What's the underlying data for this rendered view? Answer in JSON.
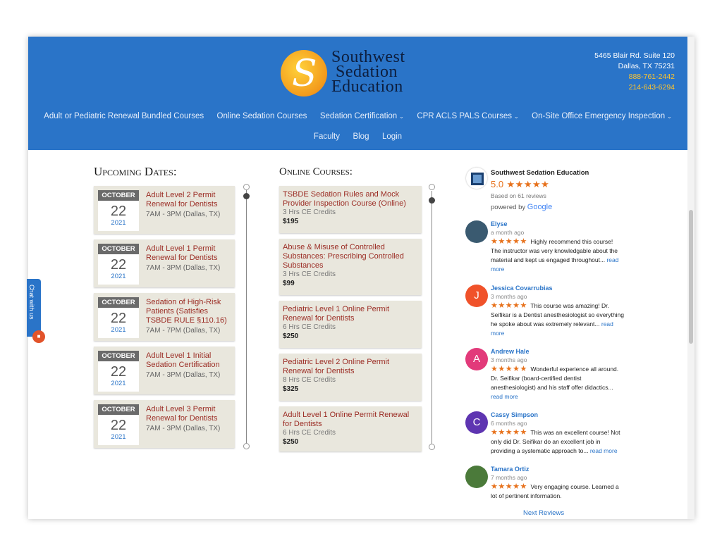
{
  "brand": {
    "logo_letter": "S",
    "logo_line1": "Southwest",
    "logo_line2": "Sedation",
    "logo_line3": "Education"
  },
  "contact": {
    "address1": "5465 Blair Rd. Suite 120",
    "address2": "Dallas, TX 75231",
    "phone1": "888-761-2442",
    "phone2": "214-643-6294"
  },
  "nav": {
    "row1": [
      {
        "label": "Adult or Pediatric Renewal Bundled Courses",
        "dropdown": false
      },
      {
        "label": "Online Sedation Courses",
        "dropdown": false
      },
      {
        "label": "Sedation Certification",
        "dropdown": true
      },
      {
        "label": "CPR ACLS PALS Courses",
        "dropdown": true
      },
      {
        "label": "On-Site Office Emergency Inspection",
        "dropdown": true
      }
    ],
    "row2": [
      {
        "label": "Faculty"
      },
      {
        "label": "Blog"
      },
      {
        "label": "Login"
      }
    ],
    "caret_glyph": "⌄"
  },
  "upcoming": {
    "title": "Upcoming Dates:",
    "events": [
      {
        "month": "OCTOBER",
        "day": "22",
        "year": "2021",
        "title": "Adult Level 2 Permit Renewal for Dentists",
        "time": "7AM - 3PM (Dallas, TX)"
      },
      {
        "month": "OCTOBER",
        "day": "22",
        "year": "2021",
        "title": "Adult Level 1 Permit Renewal for Dentists",
        "time": "7AM - 3PM (Dallas, TX)"
      },
      {
        "month": "OCTOBER",
        "day": "22",
        "year": "2021",
        "title": "Sedation of High-Risk Patients (Satisfies TSBDE RULE §110.16)",
        "time": "7AM - 7PM (Dallas, TX)"
      },
      {
        "month": "OCTOBER",
        "day": "22",
        "year": "2021",
        "title": "Adult Level 1 Initial Sedation Certification",
        "time": "7AM - 3PM (Dallas, TX)"
      },
      {
        "month": "OCTOBER",
        "day": "22",
        "year": "2021",
        "title": "Adult Level 3 Permit Renewal for Dentists",
        "time": "7AM - 3PM (Dallas, TX)"
      }
    ]
  },
  "online": {
    "title": "Online Courses:",
    "courses": [
      {
        "title": "TSBDE Sedation Rules and Mock Provider Inspection Course (Online)",
        "credits": "3 Hrs CE Credits",
        "price": "$195"
      },
      {
        "title": "Abuse & Misuse of Controlled Substances: Prescribing Controlled Substances",
        "credits": "3 Hrs CE Credits",
        "price": "$99"
      },
      {
        "title": "Pediatric Level 1 Online Permit Renewal for Dentists",
        "credits": "6 Hrs CE Credits",
        "price": "$250"
      },
      {
        "title": "Pediatric Level 2 Online Permit Renewal for Dentists",
        "credits": "8 Hrs CE Credits",
        "price": "$325"
      },
      {
        "title": "Adult Level 1 Online Permit Renewal for Dentists",
        "credits": "6 Hrs CE Credits",
        "price": "$250"
      }
    ]
  },
  "reviews_widget": {
    "business": "Southwest Sedation Education",
    "rating": "5.0",
    "stars": "★★★★★",
    "based_on": "Based on 61 reviews",
    "powered_by": "powered by",
    "google": "Google",
    "reviews": [
      {
        "initial": "",
        "color": "#3a5a70",
        "name": "Elyse",
        "when": "a month ago",
        "text": "Highly recommend this course! The instructor was very knowledgable about the material and kept us engaged throughout...",
        "more": "read more"
      },
      {
        "initial": "J",
        "color": "#f0522a",
        "name": "Jessica Covarrubias",
        "when": "3 months ago",
        "text": "This course was amazing! Dr. Seifikar is a Dentist anesthesiologist so everything he spoke about was extremely relevant...",
        "more": "read more"
      },
      {
        "initial": "A",
        "color": "#e23a7a",
        "name": "Andrew Hale",
        "when": "3 months ago",
        "text": "Wonderful experience all around.  Dr. Seifikar (board-certified dentist anesthesiologist) and his staff offer didactics...",
        "more": "read more"
      },
      {
        "initial": "C",
        "color": "#5e35b1",
        "name": "Cassy Simpson",
        "when": "6 months ago",
        "text": "This was an excellent course! Not only did Dr. Seifikar do an excellent job in providing a systematic approach to...",
        "more": "read more"
      },
      {
        "initial": "",
        "color": "#4b7a3a",
        "name": "Tamara Ortiz",
        "when": "7 months ago",
        "text": "Very engaging course. Learned a lot of pertinent information.",
        "more": ""
      }
    ],
    "next": "Next Reviews"
  },
  "chat": {
    "label": "Chat with us",
    "badge_icon": "chat-bubble-icon"
  }
}
